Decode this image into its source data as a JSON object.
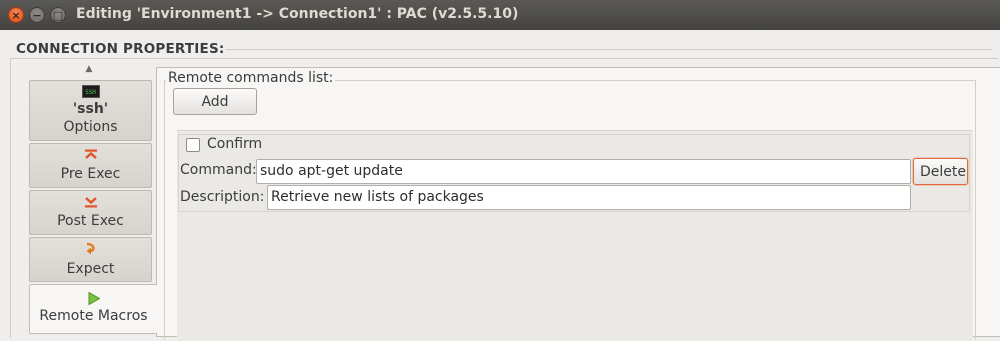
{
  "window": {
    "title": "Editing 'Environment1 -> Connection1' : PAC (v2.5.5.10)",
    "buttons": {
      "close": "×",
      "minimize": "−",
      "maximize": "□"
    }
  },
  "section_title": "CONNECTION PROPERTIES:",
  "sidebar": {
    "scroll_up_glyph": "▲",
    "tabs": [
      {
        "icon": "ssh-terminal-icon",
        "icon_text": "SSH",
        "label_top": "'ssh'",
        "label": "Options",
        "active": false
      },
      {
        "icon": "pre-exec-icon",
        "label": "Pre Exec",
        "active": false
      },
      {
        "icon": "post-exec-icon",
        "label": "Post Exec",
        "active": false
      },
      {
        "icon": "expect-icon",
        "label": "Expect",
        "active": false
      },
      {
        "icon": "play-icon",
        "label": "Remote Macros",
        "active": true
      }
    ]
  },
  "remote_commands": {
    "label": "Remote commands list:",
    "add_label": "Add",
    "macros": [
      {
        "confirm_label": "Confirm",
        "confirm_checked": false,
        "command_label": "Command:",
        "command_value": "sudo apt-get update",
        "description_label": "Description:",
        "description_value": "Retrieve new lists of packages",
        "delete_label": "Delete"
      }
    ]
  },
  "colors": {
    "accent": "#e2683a",
    "titlebar": "#4c4b47",
    "window_bg": "#efeeec"
  }
}
